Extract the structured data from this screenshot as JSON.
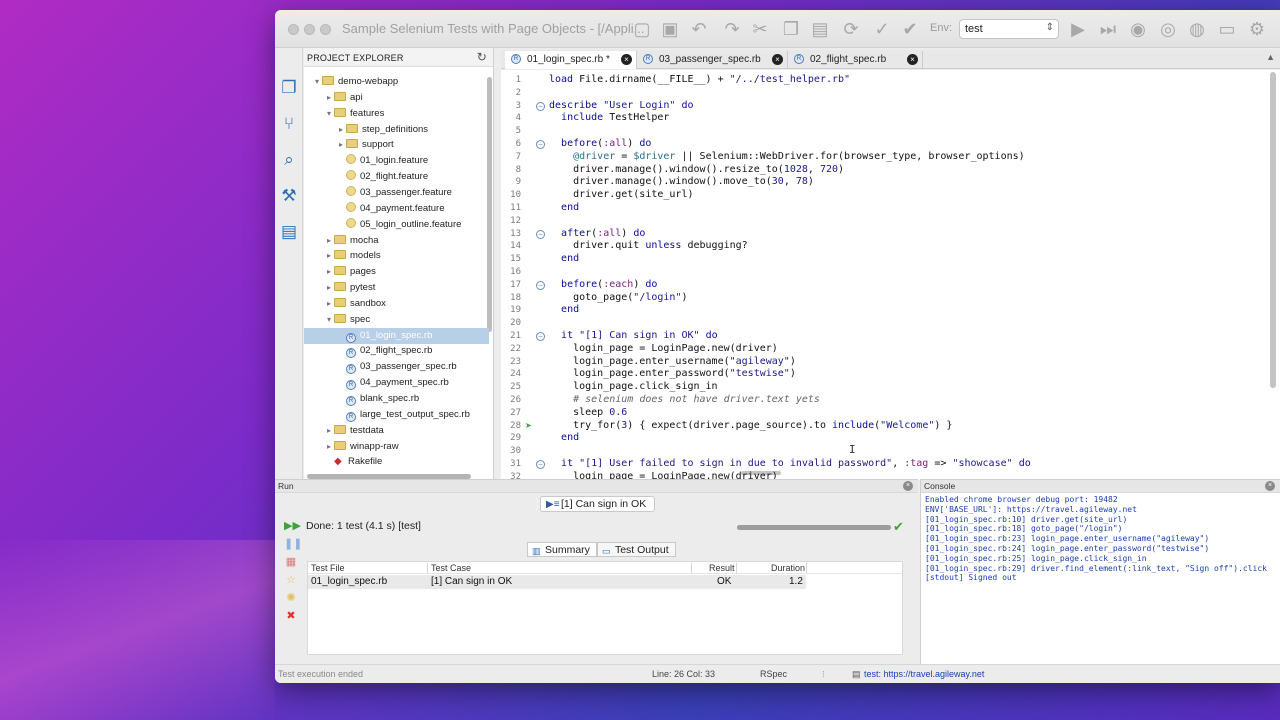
{
  "window": {
    "title": "Sample Selenium Tests with Page Objects - [/Appli...",
    "env_label": "Env:",
    "env_value": "test"
  },
  "toolbar": {
    "icons": [
      "new-file-icon",
      "save-icon",
      "undo-icon",
      "redo-icon",
      "cut-icon",
      "copy-icon",
      "paste-icon",
      "find-replace-icon",
      "check-icon",
      "run-icon",
      "run-all-icon",
      "settings-icon"
    ]
  },
  "explorer": {
    "title": "PROJECT EXPLORER",
    "items": [
      {
        "label": "demo-webapp",
        "type": "folder",
        "depth": 0,
        "expanded": true
      },
      {
        "label": "api",
        "type": "folder",
        "depth": 1,
        "expanded": false
      },
      {
        "label": "features",
        "type": "folder",
        "depth": 1,
        "expanded": true
      },
      {
        "label": "step_definitions",
        "type": "folder",
        "depth": 2,
        "expanded": false
      },
      {
        "label": "support",
        "type": "folder",
        "depth": 2,
        "expanded": false
      },
      {
        "label": "01_login.feature",
        "type": "feature",
        "depth": 2
      },
      {
        "label": "02_flight.feature",
        "type": "feature",
        "depth": 2
      },
      {
        "label": "03_passenger.feature",
        "type": "feature",
        "depth": 2
      },
      {
        "label": "04_payment.feature",
        "type": "feature",
        "depth": 2
      },
      {
        "label": "05_login_outline.feature",
        "type": "feature",
        "depth": 2
      },
      {
        "label": "mocha",
        "type": "folder",
        "depth": 1,
        "expanded": false
      },
      {
        "label": "models",
        "type": "folder",
        "depth": 1,
        "expanded": false
      },
      {
        "label": "pages",
        "type": "folder",
        "depth": 1,
        "expanded": false
      },
      {
        "label": "pytest",
        "type": "folder",
        "depth": 1,
        "expanded": false
      },
      {
        "label": "sandbox",
        "type": "folder",
        "depth": 1,
        "expanded": false
      },
      {
        "label": "spec",
        "type": "folder",
        "depth": 1,
        "expanded": true
      },
      {
        "label": "01_login_spec.rb",
        "type": "rb",
        "depth": 2,
        "selected": true
      },
      {
        "label": "02_flight_spec.rb",
        "type": "rb",
        "depth": 2
      },
      {
        "label": "03_passenger_spec.rb",
        "type": "rb",
        "depth": 2
      },
      {
        "label": "04_payment_spec.rb",
        "type": "rb",
        "depth": 2
      },
      {
        "label": "blank_spec.rb",
        "type": "rb",
        "depth": 2
      },
      {
        "label": "large_test_output_spec.rb",
        "type": "rb",
        "depth": 2
      },
      {
        "label": "testdata",
        "type": "folder",
        "depth": 1,
        "expanded": false
      },
      {
        "label": "winapp-raw",
        "type": "folder",
        "depth": 1,
        "expanded": false
      },
      {
        "label": "Rakefile",
        "type": "ruby",
        "depth": 1
      }
    ]
  },
  "tabs": [
    {
      "label": "01_login_spec.rb *",
      "active": true
    },
    {
      "label": "03_passenger_spec.rb",
      "active": false
    },
    {
      "label": "02_flight_spec.rb",
      "active": false
    }
  ],
  "editor": {
    "lines": [
      {
        "n": "1",
        "code": "load File.dirname(__FILE__) + \"/../test_helper.rb\""
      },
      {
        "n": "2",
        "code": ""
      },
      {
        "n": "3",
        "code": "describe \"User Login\" do",
        "fold": true
      },
      {
        "n": "4",
        "code": "  include TestHelper"
      },
      {
        "n": "5",
        "code": ""
      },
      {
        "n": "6",
        "code": "  before(:all) do",
        "fold": true
      },
      {
        "n": "7",
        "code": "    @driver = $driver || Selenium::WebDriver.for(browser_type, browser_options)"
      },
      {
        "n": "8",
        "code": "    driver.manage().window().resize_to(1028, 720)"
      },
      {
        "n": "9",
        "code": "    driver.manage().window().move_to(30, 78)"
      },
      {
        "n": "10",
        "code": "    driver.get(site_url)"
      },
      {
        "n": "11",
        "code": "  end"
      },
      {
        "n": "12",
        "code": ""
      },
      {
        "n": "13",
        "code": "  after(:all) do",
        "fold": true
      },
      {
        "n": "14",
        "code": "    driver.quit unless debugging?"
      },
      {
        "n": "15",
        "code": "  end"
      },
      {
        "n": "16",
        "code": ""
      },
      {
        "n": "17",
        "code": "  before(:each) do",
        "fold": true
      },
      {
        "n": "18",
        "code": "    goto_page(\"/login\")"
      },
      {
        "n": "19",
        "code": "  end"
      },
      {
        "n": "20",
        "code": ""
      },
      {
        "n": "21",
        "code": "  it \"[1] Can sign in OK\" do",
        "fold": true
      },
      {
        "n": "22",
        "code": "    login_page = LoginPage.new(driver)"
      },
      {
        "n": "23",
        "code": "    login_page.enter_username(\"agileway\")"
      },
      {
        "n": "24",
        "code": "    login_page.enter_password(\"testwise\")"
      },
      {
        "n": "25",
        "code": "    login_page.click_sign_in"
      },
      {
        "n": "26",
        "code": "    # selenium does not have driver.text yets",
        "comment": true
      },
      {
        "n": "27",
        "code": "    sleep 0.6"
      },
      {
        "n": "28",
        "code": "    try_for(3) { expect(driver.page_source).to include(\"Welcome\") }",
        "arrow": true
      },
      {
        "n": "29",
        "code": "  end"
      },
      {
        "n": "30",
        "code": ""
      },
      {
        "n": "31",
        "code": "  it \"[1] User failed to sign in due to invalid password\", :tag => \"showcase\" do",
        "fold": true
      },
      {
        "n": "32",
        "code": "    login_page = LoginPage.new(driver)"
      }
    ]
  },
  "run": {
    "panel_title": "Run",
    "current_test": "[1] Can sign in OK",
    "status": "Done: 1 test (4.1 s) [test]",
    "progress": 1.0,
    "subtabs": [
      "Summary",
      "Test Output"
    ],
    "columns": [
      "Test File",
      "Test Case",
      "Result",
      "Duration"
    ],
    "rows": [
      {
        "file": "01_login_spec.rb",
        "case": "[1] Can sign in OK",
        "result": "OK",
        "duration": "1.2"
      }
    ]
  },
  "console": {
    "title": "Console",
    "lines": [
      "Enabled chrome browser debug port: 19482",
      "ENV['BASE_URL']: https://travel.agileway.net",
      "[01_login_spec.rb:10] driver.get(site_url)",
      "[01_login_spec.rb:18] goto_page(\"/login\")",
      "[01_login_spec.rb:23] login_page.enter_username(\"agileway\")",
      "[01_login_spec.rb:24] login_page.enter_password(\"testwise\")",
      "[01_login_spec.rb:25] login_page.click_sign_in",
      "[01_login_spec.rb:29] driver.find_element(:link_text, \"Sign off\").click",
      "[stdout] Signed out"
    ]
  },
  "statusbar": {
    "message": "Test execution ended",
    "position": "Line: 26  Col: 33",
    "mode": "RSpec",
    "url": "test: https://travel.agileway.net"
  },
  "colors": {
    "accent": "#2d6fb5",
    "selection": "#b8cfe8",
    "ok_green": "#3aa33a",
    "console_text": "#1a3fb0"
  }
}
